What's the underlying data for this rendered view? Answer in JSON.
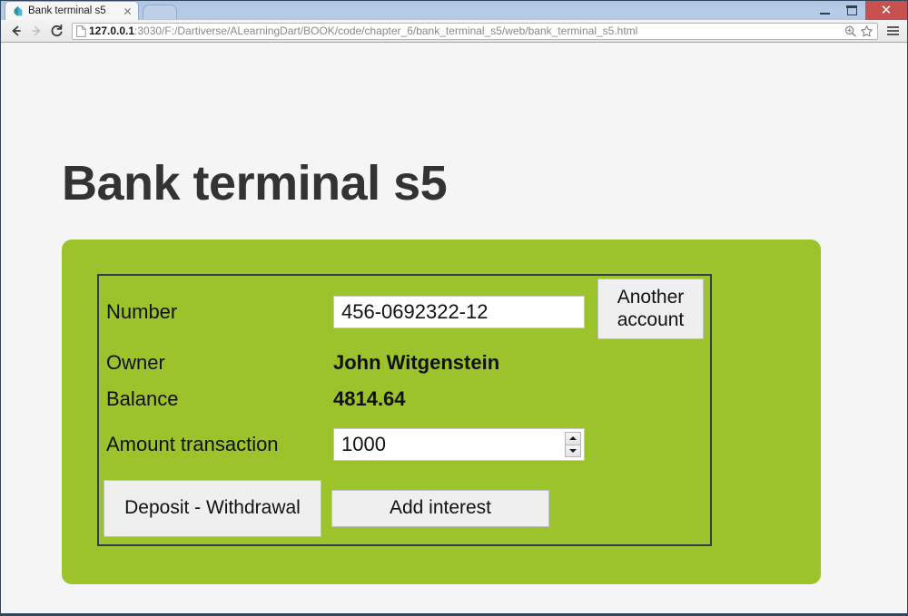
{
  "browser": {
    "tab": {
      "title": "Bank terminal s5",
      "favicon_icon": "dart-logo-icon",
      "close_icon": "close-icon"
    },
    "new_tab_icon": "new-tab-icon",
    "window_controls": {
      "minimize_icon": "minimize-icon",
      "maximize_icon": "restore-icon",
      "close_label": "✕",
      "close_icon": "window-close-icon",
      "close_color": "#c75050"
    },
    "nav": {
      "back_icon": "back-arrow-icon",
      "forward_icon": "forward-arrow-icon",
      "reload_icon": "reload-icon"
    },
    "omnibox": {
      "page_icon": "page-document-icon",
      "host": "127.0.0.1",
      "path": ":3030/F:/Dartiverse/ALearningDart/BOOK/code/chapter_6/bank_terminal_s5/web/bank_terminal_s5.html",
      "zoom_icon": "zoom-magnifier-icon",
      "bookmark_icon": "star-icon"
    },
    "menu_icon": "hamburger-menu-icon"
  },
  "page": {
    "title": "Bank terminal s5",
    "panel_color": "#9cc22c",
    "fieldset_border_color": "#2c3e50",
    "background_color": "#f5f5f5",
    "fields": {
      "number_label": "Number",
      "number_value": "456-0692322-12",
      "owner_label": "Owner",
      "owner_value": "John Witgenstein",
      "balance_label": "Balance",
      "balance_value": "4814.64",
      "amount_label": "Amount transaction",
      "amount_value": "1000"
    },
    "buttons": {
      "another_account": "Another account",
      "deposit_withdrawal": "Deposit - Withdrawal",
      "add_interest": "Add interest"
    }
  }
}
